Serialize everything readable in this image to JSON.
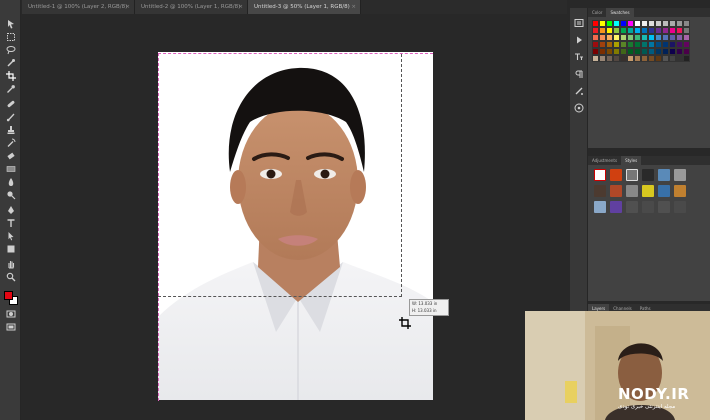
{
  "tabs": [
    {
      "label": "Untitled-1 @ 100% (Layer 2, RGB/8)",
      "close": "×",
      "active": false
    },
    {
      "label": "Untitled-2 @ 100% (Layer 1, RGB/8)",
      "close": "×",
      "active": false
    },
    {
      "label": "Untitled-3 @ 50% (Layer 1, RGB/8)",
      "close": "×",
      "active": true
    }
  ],
  "tooltip": {
    "w_label": "W:",
    "w_value": "13.033 in",
    "h_label": "H:",
    "h_value": "13.033 in"
  },
  "panels": {
    "color": {
      "tabs": [
        "Color",
        "Swatches"
      ],
      "active": "Swatches"
    },
    "styles": {
      "tabs": [
        "Adjustments",
        "Styles"
      ],
      "active": "Styles"
    },
    "layers": {
      "tabs": [
        "Layers",
        "Channels",
        "Paths"
      ],
      "active": "Layers"
    }
  },
  "colors": {
    "foreground": "#e30613",
    "background": "#ffffff"
  },
  "watermark": {
    "title": "NODY.IR",
    "subtitle": "مجله اینترنتی خبری نودی"
  }
}
